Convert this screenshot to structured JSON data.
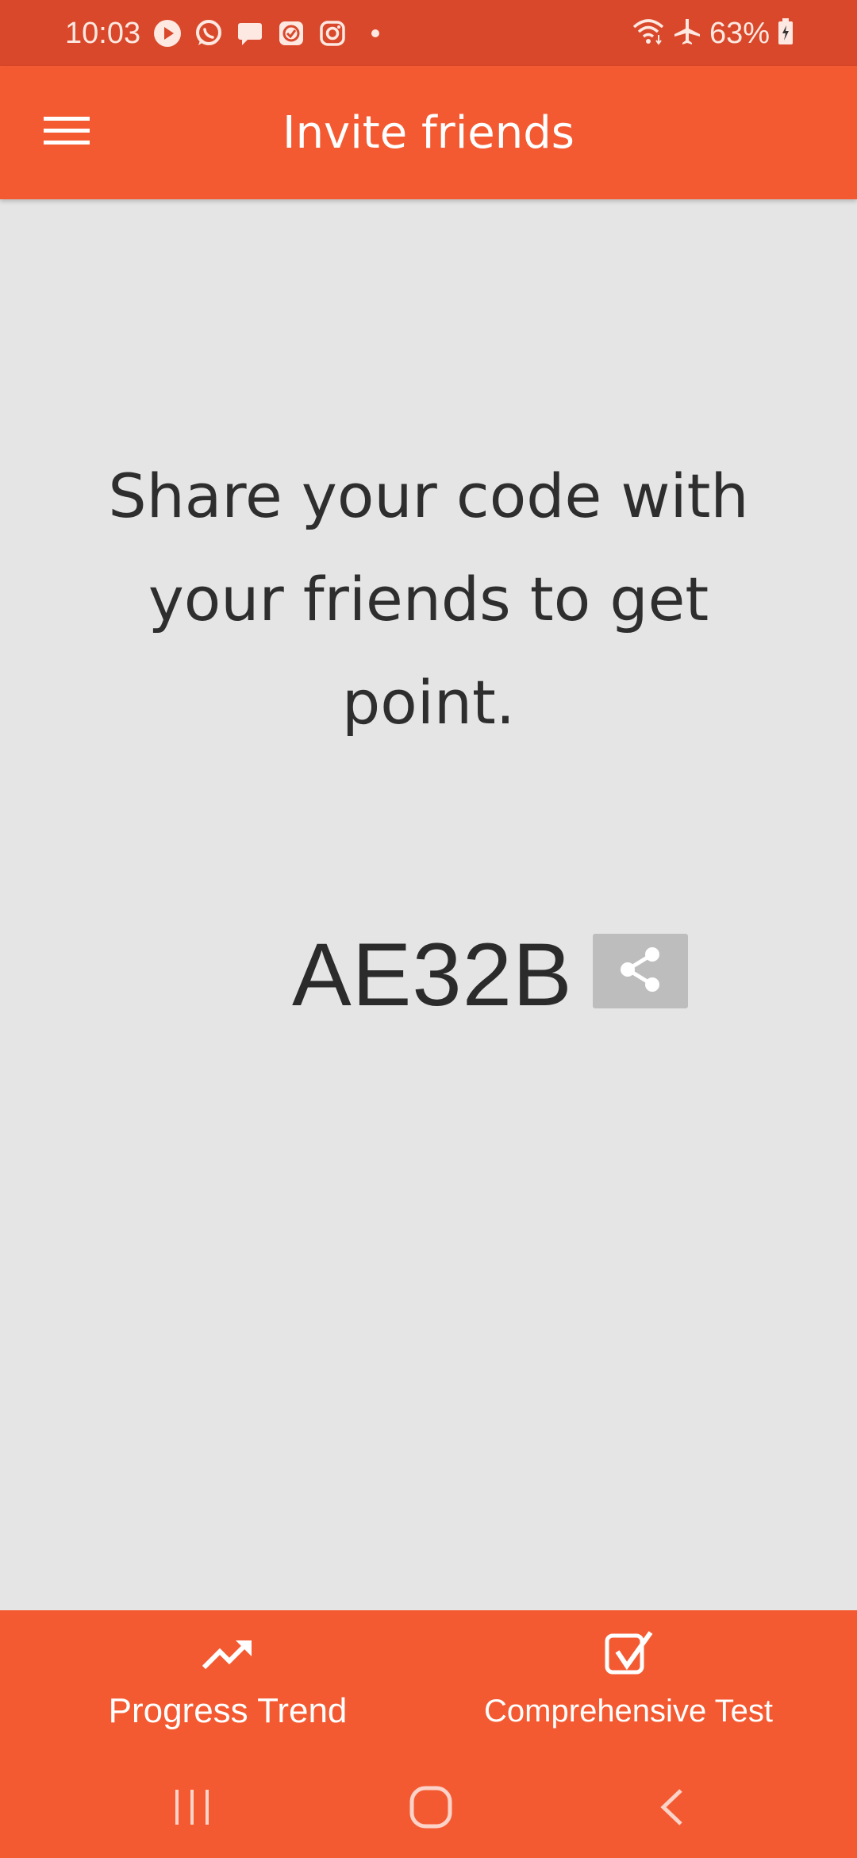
{
  "status_bar": {
    "time": "10:03",
    "battery": "63%",
    "icons": [
      "youtube-icon",
      "whatsapp-icon",
      "message-icon",
      "task-icon",
      "instagram-icon",
      "dot-icon",
      "wifi-icon",
      "airplane-mode-icon",
      "battery-icon"
    ]
  },
  "app_bar": {
    "title": "Invite friends",
    "menu_icon": "hamburger-menu-icon"
  },
  "main": {
    "message": "Share your code with your friends to get point.",
    "invite_code": "AE32B",
    "share_icon": "share-icon"
  },
  "bottom_nav": {
    "items": [
      {
        "label": "Progress Trend",
        "icon": "trending-up-icon"
      },
      {
        "label": "Comprehensive Test",
        "icon": "checklist-icon"
      }
    ]
  },
  "system_nav": {
    "buttons": [
      "recents-icon",
      "home-icon",
      "back-icon"
    ]
  },
  "colors": {
    "status_bar": "#d9482a",
    "primary": "#f45a32",
    "background": "#e5e5e5",
    "text": "#2e2e2e",
    "share_button": "#bdbdbd"
  }
}
